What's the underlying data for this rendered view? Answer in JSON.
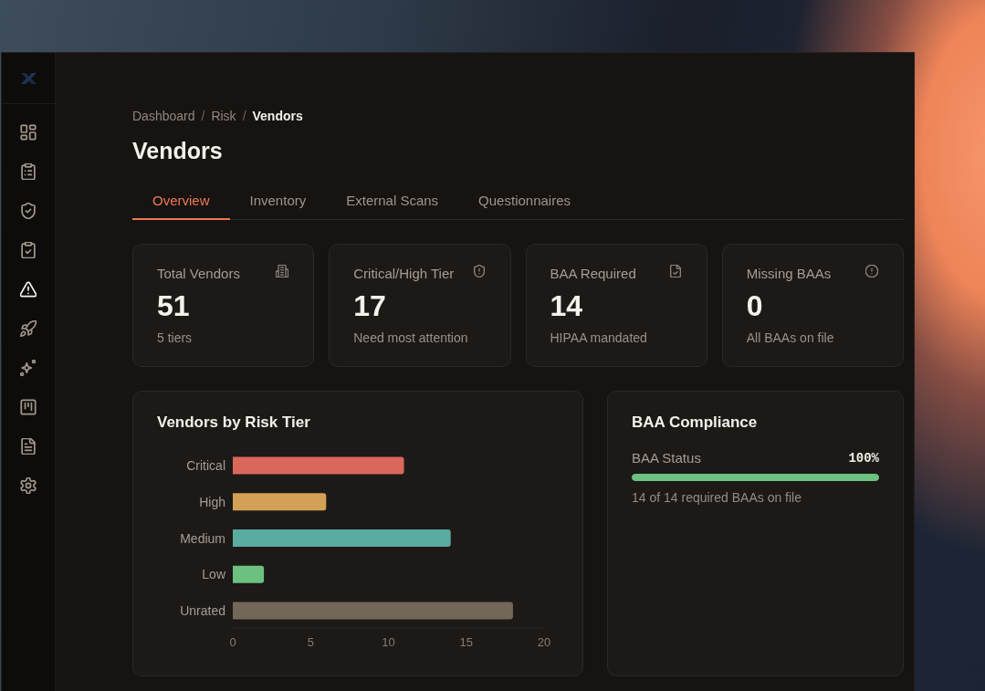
{
  "sidebar": {
    "items": [
      {
        "selected": false
      },
      {
        "selected": false
      },
      {
        "selected": false
      },
      {
        "selected": false
      },
      {
        "selected": true
      },
      {
        "selected": false
      },
      {
        "selected": false
      },
      {
        "selected": false
      },
      {
        "selected": false
      },
      {
        "selected": false
      }
    ]
  },
  "breadcrumb": {
    "items": [
      {
        "label": "Dashboard",
        "current": false
      },
      {
        "label": "Risk",
        "current": false
      },
      {
        "label": "Vendors",
        "current": true
      }
    ],
    "separators": [
      "/",
      "/"
    ]
  },
  "page_title": "Vendors",
  "tabs": [
    {
      "label": "Overview",
      "selected": true
    },
    {
      "label": "Inventory",
      "selected": false
    },
    {
      "label": "External Scans",
      "selected": false
    },
    {
      "label": "Questionnaires",
      "selected": false
    }
  ],
  "stat_cards": [
    {
      "label": "Total Vendors",
      "value": "51",
      "note": "5 tiers"
    },
    {
      "label": "Critical/High Tier",
      "value": "17",
      "note": "Need most attention"
    },
    {
      "label": "BAA Required",
      "value": "14",
      "note": "HIPAA mandated"
    },
    {
      "label": "Missing BAAs",
      "value": "0",
      "note": "All BAAs on file"
    }
  ],
  "risk_tier_chart": {
    "title": "Vendors by Risk Tier",
    "chart_data": {
      "type": "bar",
      "orientation": "horizontal",
      "categories": [
        "Critical",
        "High",
        "Medium",
        "Low",
        "Unrated"
      ],
      "values": [
        11,
        6,
        14,
        2,
        18
      ],
      "colors": [
        "#d9675c",
        "#d4a055",
        "#5aaba0",
        "#6cc080",
        "#736759"
      ],
      "xlim": [
        0,
        20
      ],
      "xticks": [
        0,
        5,
        10,
        15,
        20
      ]
    }
  },
  "baa_compliance": {
    "title": "BAA Compliance",
    "status": {
      "label": "BAA Status",
      "reading": "100%",
      "level": 1
    },
    "note": "14 of 14 required BAAs on file"
  }
}
